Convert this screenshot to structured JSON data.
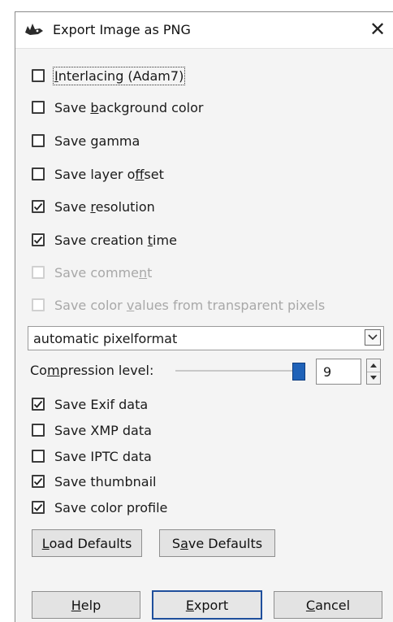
{
  "window": {
    "title": "Export Image as PNG",
    "app_icon": "gimp-wilber-icon",
    "close_glyph": "✕"
  },
  "options_top": [
    {
      "pre": "",
      "u": "I",
      "post": "nterlacing (Adam7)",
      "checked": false,
      "enabled": true,
      "focused": true
    },
    {
      "pre": "Save ",
      "u": "b",
      "post": "ackground color",
      "checked": false,
      "enabled": true
    },
    {
      "pre": "Save ",
      "u": "g",
      "post": "amma",
      "checked": false,
      "enabled": true
    },
    {
      "pre": "Save layer o",
      "u": "f",
      "post": "fset",
      "checked": false,
      "enabled": true
    },
    {
      "pre": "Save ",
      "u": "r",
      "post": "esolution",
      "checked": true,
      "enabled": true
    },
    {
      "pre": "Save creation ",
      "u": "t",
      "post": "ime",
      "checked": true,
      "enabled": true
    },
    {
      "pre": "Save comme",
      "u": "n",
      "post": "t",
      "checked": false,
      "enabled": false
    },
    {
      "pre": "Save color ",
      "u": "v",
      "post": "alues from transparent pixels",
      "checked": false,
      "enabled": false
    }
  ],
  "pixelformat": {
    "value": "automatic pixelformat",
    "arrow_icon": "chevron-down-icon"
  },
  "compression": {
    "pre": "Co",
    "u": "m",
    "post": "pression level:",
    "value": "9",
    "min": 0,
    "max": 9
  },
  "options_bottom": [
    {
      "label": "Save Exif data",
      "checked": true
    },
    {
      "label": "Save XMP data",
      "checked": false
    },
    {
      "label": "Save IPTC data",
      "checked": false
    },
    {
      "label": "Save thumbnail",
      "checked": true
    },
    {
      "label": "Save color profile",
      "checked": true
    }
  ],
  "defaults_buttons": {
    "load": {
      "u": "L",
      "post": "oad Defaults"
    },
    "save": {
      "pre": "S",
      "u": "a",
      "post": "ve Defaults"
    }
  },
  "actions": {
    "help": {
      "u": "H",
      "post": "elp"
    },
    "export": {
      "u": "E",
      "post": "xport"
    },
    "cancel": {
      "u": "C",
      "post": "ancel"
    }
  },
  "colors": {
    "accent": "#1f62b8",
    "default_button_border": "#1f4f9c",
    "disabled_text": "#a8a8a8"
  }
}
